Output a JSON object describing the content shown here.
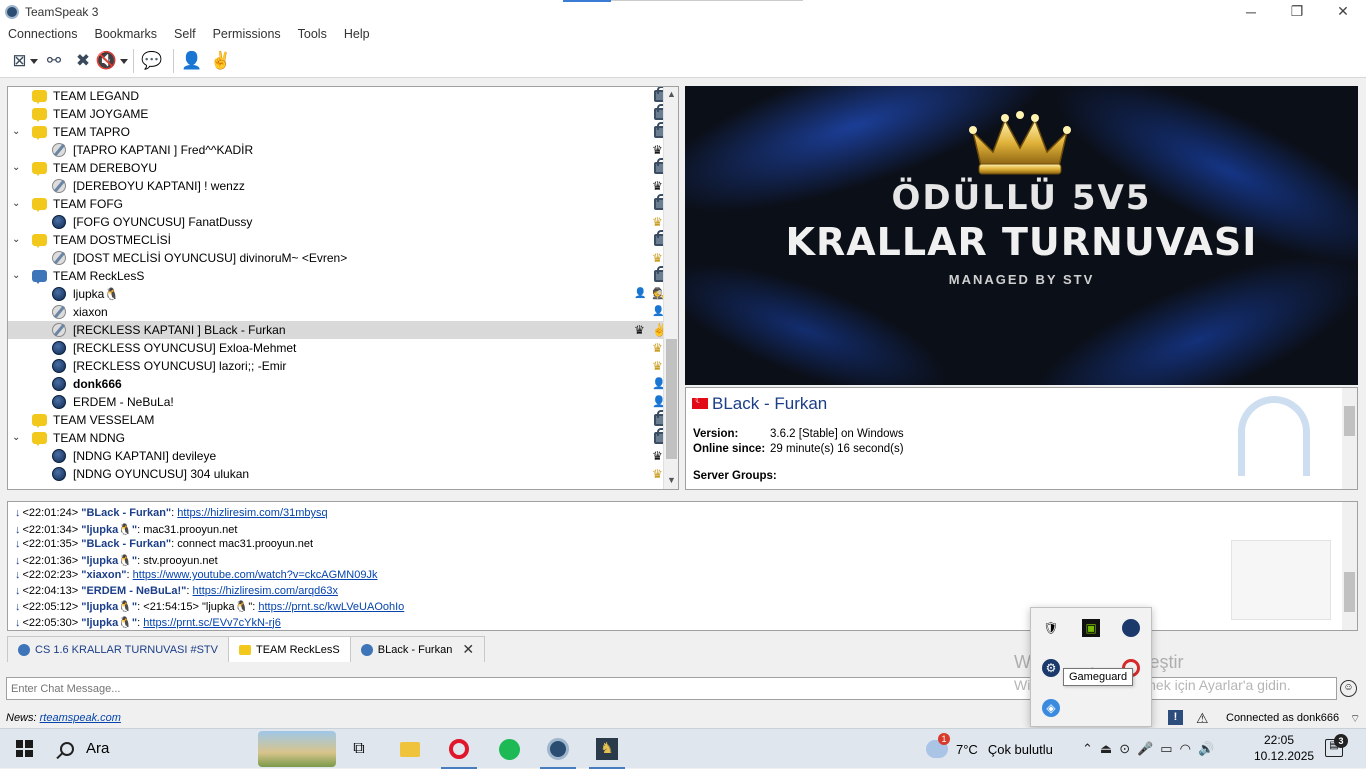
{
  "window": {
    "title": "TeamSpeak 3",
    "buttons": [
      "─",
      "❐",
      "✕"
    ]
  },
  "menu": [
    "Connections",
    "Bookmarks",
    "Self",
    "Permissions",
    "Tools",
    "Help"
  ],
  "tree": [
    {
      "type": "channel",
      "label": "TEAM LEGAND",
      "expanded": null,
      "icons": [
        "lock"
      ]
    },
    {
      "type": "channel",
      "label": "TEAM JOYGAME",
      "expanded": null,
      "icons": [
        "lock"
      ]
    },
    {
      "type": "channel",
      "label": "TEAM TAPRO",
      "expanded": true,
      "icons": [
        "lock"
      ]
    },
    {
      "type": "user",
      "label": "[TAPRO KAPTANI  ] Fred^^KADİR",
      "icons": [
        "crown-black"
      ]
    },
    {
      "type": "channel",
      "label": "TEAM DEREBOYU",
      "expanded": true,
      "icons": [
        "lock"
      ]
    },
    {
      "type": "user",
      "label": "[DEREBOYU KAPTANI] !                    wenzz",
      "icons": [
        "crown-black"
      ]
    },
    {
      "type": "channel",
      "label": "TEAM FOFG",
      "expanded": true,
      "icons": [
        "lock"
      ]
    },
    {
      "type": "user",
      "label": "[FOFG OYUNCUSU] FanatDussy",
      "icons": [
        "crown-gold"
      ]
    },
    {
      "type": "channel",
      "label": "TEAM DOSTMECLİSİ",
      "expanded": true,
      "icons": [
        "lock"
      ]
    },
    {
      "type": "user",
      "label": "[DOST MECLİSİ OYUNCUSU] divinoruM~ <Evren>",
      "icons": [
        "crown-gold"
      ]
    },
    {
      "type": "channel",
      "label": "TEAM ReckLesS",
      "expanded": true,
      "icons": [
        "lock"
      ]
    },
    {
      "type": "user",
      "label": "ljupka🐧",
      "icons": [
        "queue",
        "red-spy"
      ]
    },
    {
      "type": "user",
      "label": "xiaxon",
      "icons": [
        "queue"
      ]
    },
    {
      "type": "user",
      "label": "[RECKLESS KAPTANI ] BLack - Furkan",
      "icons": [
        "crown-black",
        "ts-logo"
      ],
      "selected": true
    },
    {
      "type": "user",
      "label": "[RECKLESS OYUNCUSU] Exloa-Mehmet",
      "icons": [
        "crown-gold"
      ]
    },
    {
      "type": "user",
      "label": "[RECKLESS OYUNCUSU] lazori;; -Emir",
      "icons": [
        "crown-gold"
      ]
    },
    {
      "type": "user",
      "label": "donk666",
      "icons": [
        "user-blue"
      ],
      "bold": true
    },
    {
      "type": "user",
      "label": "ERDEM - NeBuLa!",
      "icons": [
        "user-blue"
      ]
    },
    {
      "type": "channel",
      "label": "TEAM VESSELAM",
      "expanded": null,
      "icons": [
        "lock"
      ]
    },
    {
      "type": "channel",
      "label": "TEAM NDNG",
      "expanded": true,
      "icons": [
        "lock"
      ]
    },
    {
      "type": "user",
      "label": "[NDNG KAPTANI] devileye",
      "icons": [
        "crown-black"
      ]
    },
    {
      "type": "user",
      "label": "[NDNG OYUNCUSU] 304 ulukan",
      "icons": [
        "crown-gold"
      ]
    }
  ],
  "banner": {
    "line1": "ÖDÜLLÜ 5V5",
    "line2": "KRALLAR TURNUVASI",
    "line3": "MANAGED BY STV"
  },
  "info": {
    "name": "BLack - Furkan",
    "version_label": "Version:",
    "version_value": "3.6.2 [Stable] on Windows",
    "online_label": "Online since:",
    "online_value": "29 minute(s) 16 second(s)",
    "groups_label": "Server Groups:"
  },
  "chat": [
    {
      "time": "<22:01:24>",
      "name": "\"BLack - Furkan\"",
      "text": ": ",
      "link": "https://hizliresim.com/31mbysq"
    },
    {
      "time": "<22:01:34>",
      "name": "\"ljupka🐧\"",
      "text": ": mac31.prooyun.net",
      "link": ""
    },
    {
      "time": "<22:01:35>",
      "name": "\"BLack - Furkan\"",
      "text": ": connect mac31.prooyun.net",
      "link": ""
    },
    {
      "time": "<22:01:36>",
      "name": "\"ljupka🐧\"",
      "text": ": stv.prooyun.net",
      "link": ""
    },
    {
      "time": "<22:02:23>",
      "name": "\"xiaxon\"",
      "text": ": ",
      "link": "https://www.youtube.com/watch?v=ckcAGMN09Jk"
    },
    {
      "time": "<22:04:13>",
      "name": "\"ERDEM - NeBuLa!\"",
      "text": ": ",
      "link": "https://hizliresim.com/arqd63x"
    },
    {
      "time": "<22:05:12>",
      "name": "\"ljupka🐧\"",
      "text": ": <21:54:15> \"ljupka🐧\": ",
      "link": "https://prnt.sc/kwLVeUAOohIo"
    },
    {
      "time": "<22:05:30>",
      "name": "\"ljupka🐧\"",
      "text": ": ",
      "link": "https://prnt.sc/EVv7cYkN-rj6"
    }
  ],
  "tabs": [
    {
      "label": "CS 1.6 KRALLAR TURNUVASI #STV",
      "active": false
    },
    {
      "label": "TEAM ReckLesS",
      "active": true
    },
    {
      "label": "BLack - Furkan",
      "active": false,
      "close": "✕"
    }
  ],
  "chat_input": {
    "placeholder": "Enter Chat Message..."
  },
  "status": {
    "news_label": "News:",
    "news_link": "rteamspeak.com",
    "connected": "Connected as donk666"
  },
  "watermark": {
    "line1": "Windows'u Etkinleştir",
    "line2": "Windows'u etkinleştirmek için Ayarlar'a gidin."
  },
  "tray_tooltip": "Gameguard",
  "taskbar": {
    "search": "Ara",
    "weather_temp": "7°C",
    "weather_text": "Çok bulutlu",
    "time": "22:05",
    "date": "10.12.2025",
    "notifications": "3"
  },
  "colors": {
    "accent": "#1c3e88",
    "channel": "#f2c81c",
    "selected_row": "#d9d9d9"
  }
}
